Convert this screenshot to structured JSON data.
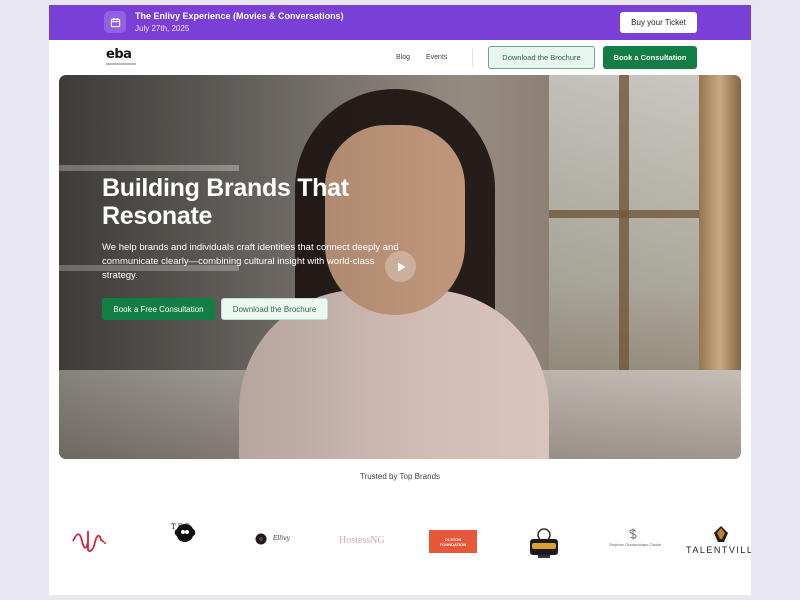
{
  "announcement": {
    "title": "The Enlivy Experience (Movies & Conversations)",
    "date": "July 27th, 2025",
    "cta": "Buy your Ticket",
    "icon": "calendar-icon"
  },
  "nav": {
    "logo": "eba",
    "links": [
      "Blog",
      "Events"
    ],
    "download_label": "Download the Brochure",
    "consult_label": "Book a Consultation"
  },
  "hero": {
    "heading": "Building Brands That Resonate",
    "description": "We help brands and individuals craft identities that connect deeply and communicate clearly—combining cultural insight with world-class strategy.",
    "primary_cta": "Book a Free Consultation",
    "secondary_cta": "Download the Brochure",
    "play_icon": "play-icon"
  },
  "trusted": {
    "heading": "Trusted by Top Brands",
    "logos": {
      "tee": "TEE",
      "ellivy": "Ellivy",
      "hostess": "HostessNG",
      "olston": "OLSTON FOUNDATION",
      "stephen": "Stephen Oluwadolapo Olaide",
      "talent": "TALENTVILLE"
    }
  },
  "colors": {
    "announce_bg": "#7a3fd6",
    "primary_green": "#127e45",
    "outline_green_bg": "#e9f6ef"
  }
}
